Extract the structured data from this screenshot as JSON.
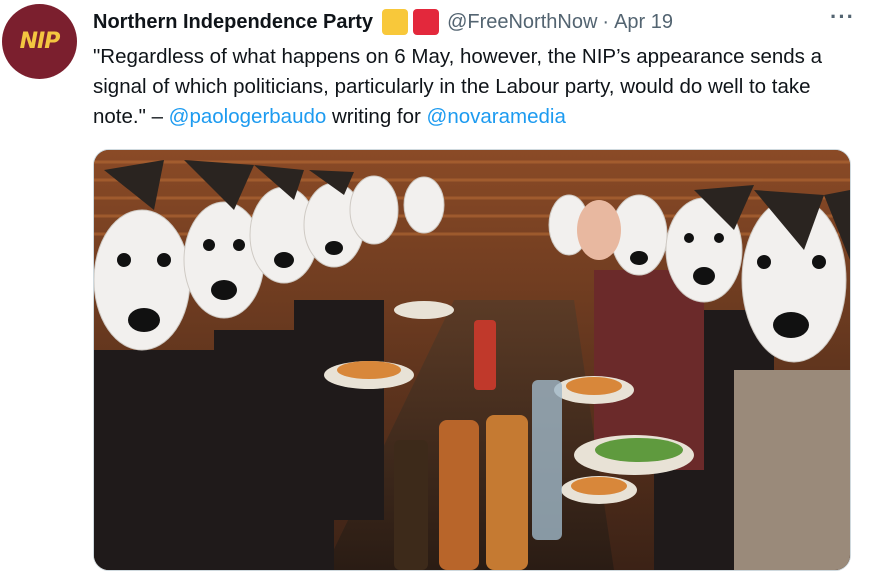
{
  "author": {
    "avatar_text": "NIP",
    "display_name": "Northern Independence Party",
    "badges": [
      {
        "icon": "yellow-square-icon",
        "color": "#f8c83a"
      },
      {
        "icon": "red-square-icon",
        "color": "#e3283c"
      }
    ],
    "handle": "@FreeNorthNow",
    "separator": "·",
    "date": "Apr 19"
  },
  "menu": {
    "icon": "more-options-icon",
    "label": "···"
  },
  "tweet": {
    "text_part1": "\"Regardless of what happens on 6 May, however, the NIP’s appearance sends a signal of which politicians, particularly in the Labour party, would do well to take note.\" – ",
    "mention1": "@paologerbaudo",
    "text_part2": " writing for ",
    "mention2": "@novaramedia"
  },
  "colors": {
    "link": "#1d9bf0",
    "secondary": "#536471",
    "avatar_bg": "#7b1f2e",
    "avatar_text": "#f3c640"
  }
}
